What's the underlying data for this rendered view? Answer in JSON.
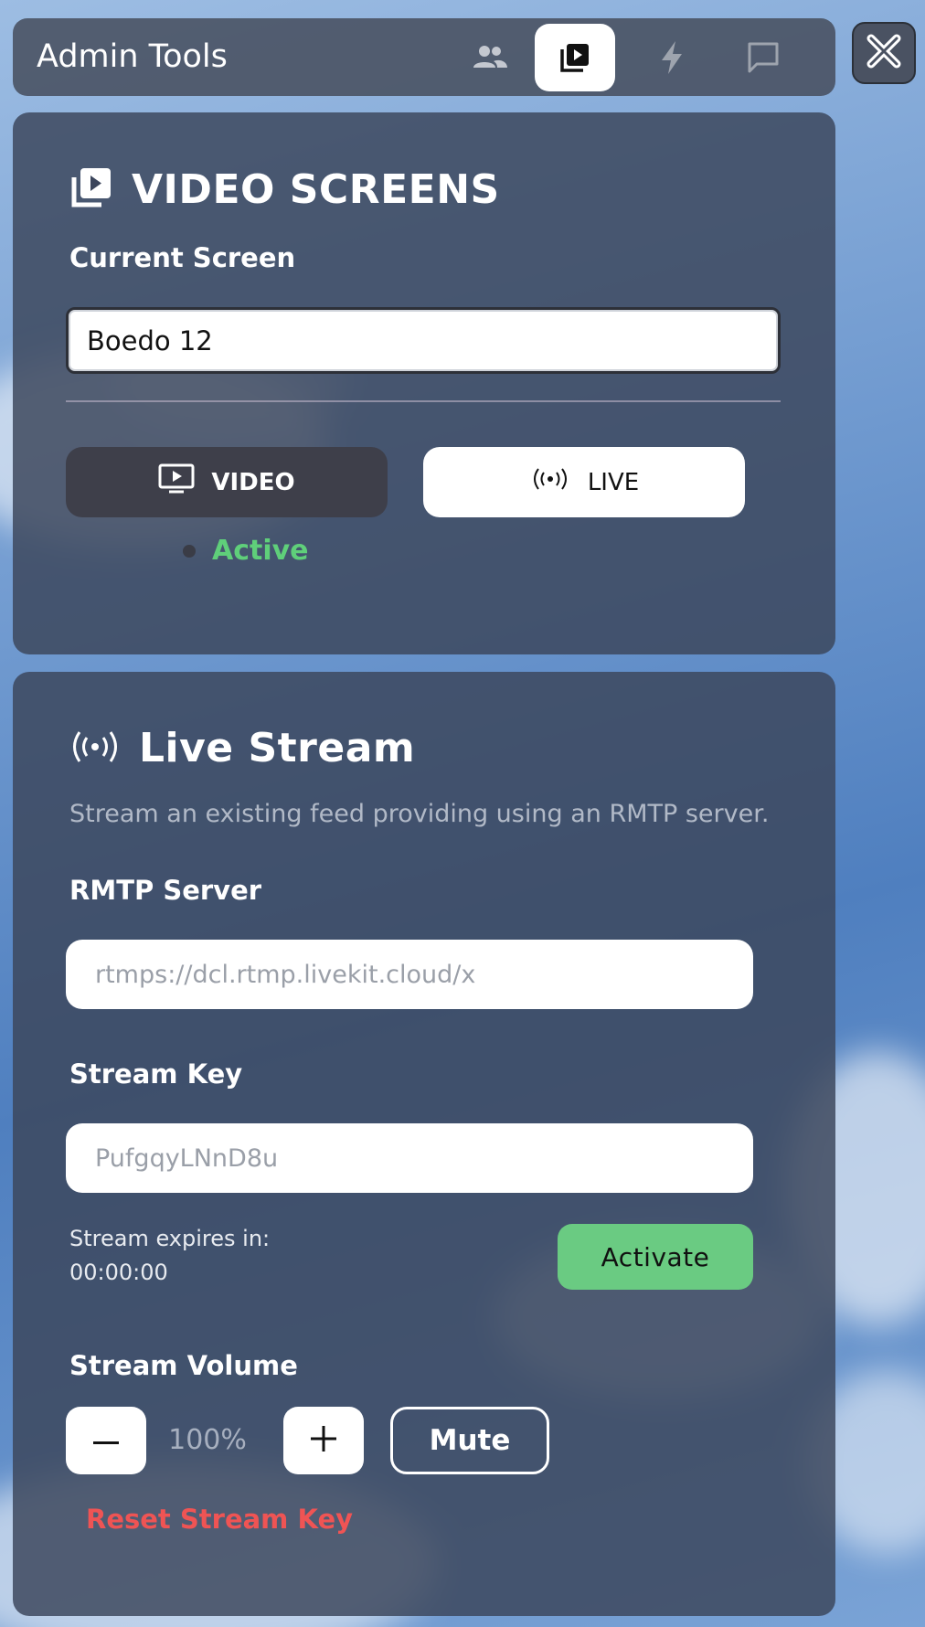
{
  "header": {
    "title": "Admin Tools",
    "tabs": [
      {
        "icon": "users-icon"
      },
      {
        "icon": "video-library-icon",
        "active": true
      },
      {
        "icon": "lightning-icon"
      },
      {
        "icon": "chat-icon"
      }
    ],
    "close_icon": "close-icon"
  },
  "video_screens": {
    "title": "VIDEO SCREENS",
    "current_screen_label": "Current Screen",
    "current_screen_value": "Boedo 12",
    "video_button_label": "VIDEO",
    "live_button_label": "LIVE",
    "status_text": "Active"
  },
  "live_stream": {
    "title": "Live Stream",
    "description": "Stream an existing feed providing using an RMTP server.",
    "server_label": "RMTP Server",
    "server_placeholder": "rtmps://dcl.rtmp.livekit.cloud/x",
    "key_label": "Stream Key",
    "key_placeholder": "PufgqyLNnD8u",
    "expires_label": "Stream expires in:",
    "expires_value": "00:00:00",
    "activate_label": "Activate",
    "volume_label": "Stream Volume",
    "volume_value": "100%",
    "mute_label": "Mute",
    "reset_label": "Reset Stream Key"
  },
  "colors": {
    "active_green": "#5fcf7a",
    "activate_button": "#6acb82",
    "reset_red": "#ef5454",
    "panel_bg": "#3c465c"
  }
}
